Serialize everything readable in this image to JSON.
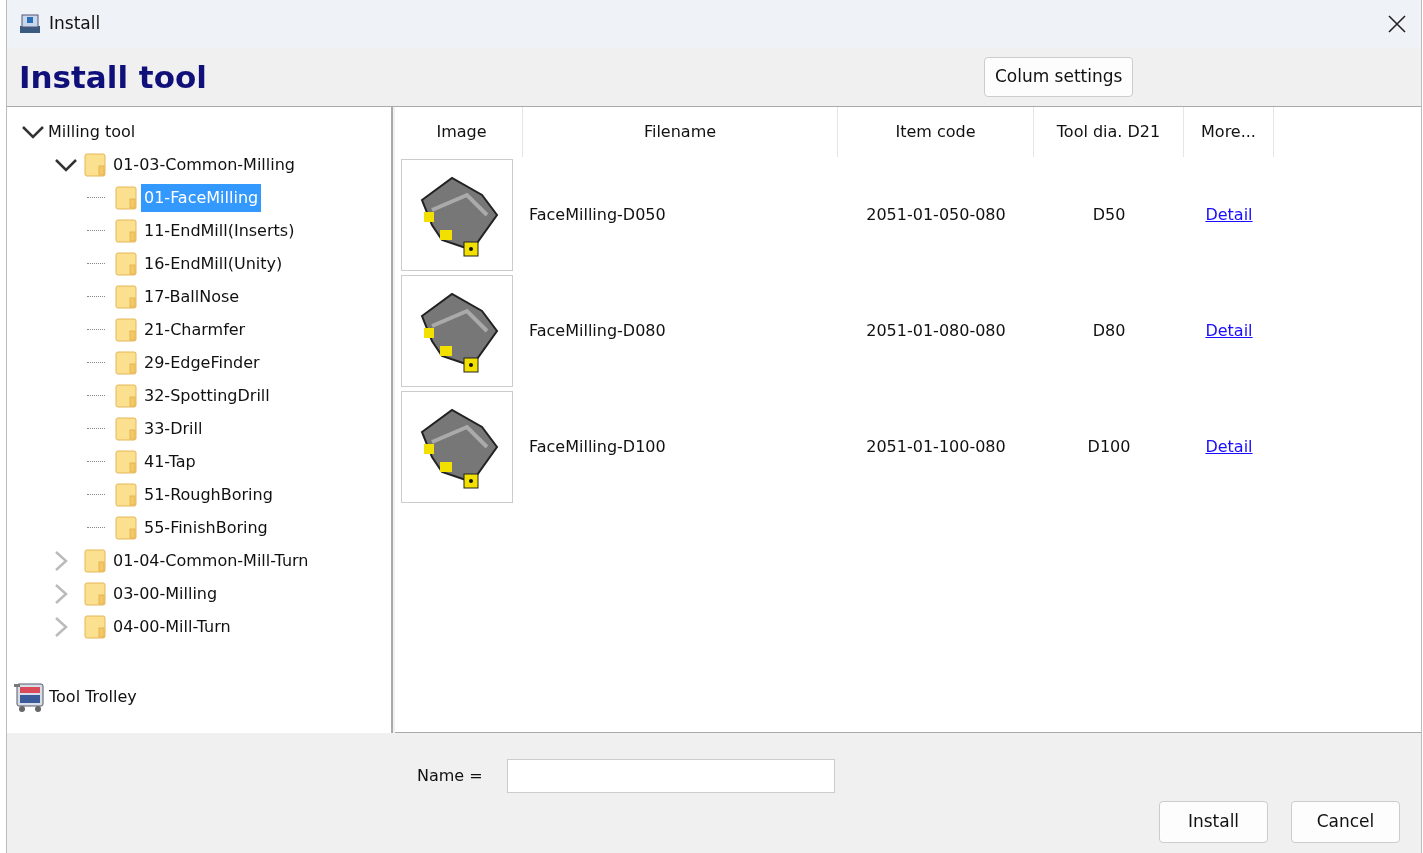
{
  "window": {
    "title": "Install"
  },
  "header": {
    "title": "Install tool",
    "column_settings_button": "Colum settings"
  },
  "tree": [
    {
      "label": "Milling tool",
      "expanded": true,
      "selected": false,
      "children": [
        {
          "label": "01-03-Common-Milling",
          "expanded": true,
          "selected": false,
          "children": [
            {
              "label": "01-FaceMilling",
              "selected": true
            },
            {
              "label": "11-EndMill(Inserts)",
              "selected": false
            },
            {
              "label": "16-EndMill(Unity)",
              "selected": false
            },
            {
              "label": "17-BallNose",
              "selected": false
            },
            {
              "label": "21-Charmfer",
              "selected": false
            },
            {
              "label": "29-EdgeFinder",
              "selected": false
            },
            {
              "label": "32-SpottingDrill",
              "selected": false
            },
            {
              "label": "33-Drill",
              "selected": false
            },
            {
              "label": "41-Tap",
              "selected": false
            },
            {
              "label": "51-RoughBoring",
              "selected": false
            },
            {
              "label": "55-FinishBoring",
              "selected": false
            }
          ]
        },
        {
          "label": "01-04-Common-Mill-Turn",
          "expanded": false,
          "selected": false
        },
        {
          "label": "03-00-Milling",
          "expanded": false,
          "selected": false
        },
        {
          "label": "04-00-Mill-Turn",
          "expanded": false,
          "selected": false
        }
      ]
    }
  ],
  "tool_trolley": "Tool Trolley",
  "table": {
    "columns": [
      "Image",
      "Filename",
      "Item code",
      "Tool dia. D21",
      "More..."
    ],
    "rows": [
      {
        "filename": "FaceMilling-D050",
        "item_code": "2051-01-050-080",
        "diameter": "D50",
        "more": "Detail"
      },
      {
        "filename": "FaceMilling-D080",
        "item_code": "2051-01-080-080",
        "diameter": "D80",
        "more": "Detail"
      },
      {
        "filename": "FaceMilling-D100",
        "item_code": "2051-01-100-080",
        "diameter": "D100",
        "more": "Detail"
      }
    ]
  },
  "name_field": {
    "label": "Name ="
  },
  "buttons": [
    "Install",
    "Cancel"
  ]
}
